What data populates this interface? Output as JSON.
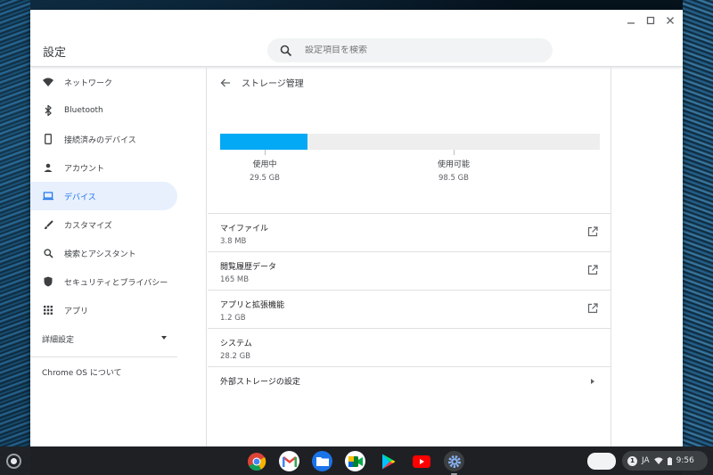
{
  "window": {
    "title": "設定",
    "search_placeholder": "設定項目を検索",
    "controls": [
      "minimize",
      "maximize",
      "close"
    ]
  },
  "sidebar": {
    "items": [
      {
        "label": "ネットワーク",
        "icon": "wifi-icon"
      },
      {
        "label": "Bluetooth",
        "icon": "bluetooth-icon"
      },
      {
        "label": "接続済みのデバイス",
        "icon": "phone-icon"
      },
      {
        "label": "アカウント",
        "icon": "person-icon"
      },
      {
        "label": "デバイス",
        "icon": "laptop-icon",
        "active": true
      },
      {
        "label": "カスタマイズ",
        "icon": "brush-icon"
      },
      {
        "label": "検索とアシスタント",
        "icon": "search-icon"
      },
      {
        "label": "セキュリティとプライバシー",
        "icon": "shield-icon"
      },
      {
        "label": "アプリ",
        "icon": "apps-grid-icon"
      }
    ],
    "advanced_label": "詳細設定",
    "about_label": "Chrome OS について"
  },
  "main": {
    "page_title": "ストレージ管理",
    "storage": {
      "used_fraction": 0.23,
      "used_label": "使用中",
      "used_value": "29.5 GB",
      "available_label": "使用可能",
      "available_value": "98.5 GB"
    },
    "rows": [
      {
        "title": "マイファイル",
        "value": "3.8 MB",
        "action": "external-link"
      },
      {
        "title": "閲覧履歴データ",
        "value": "165 MB",
        "action": "external-link"
      },
      {
        "title": "アプリと拡張機能",
        "value": "1.2 GB",
        "action": "external-link"
      },
      {
        "title": "システム",
        "value": "28.2 GB",
        "action": "none"
      }
    ],
    "external_storage_label": "外部ストレージの設定"
  },
  "shelf": {
    "apps": [
      "chrome-icon",
      "gmail-icon",
      "files-icon",
      "meet-icon",
      "play-store-icon",
      "youtube-icon",
      "settings-icon"
    ],
    "tray": {
      "notification_count": "1",
      "ime": "JA",
      "time": "9:56"
    }
  },
  "colors": {
    "accent": "#1a73e8",
    "storage_bar": "#03a9f4",
    "active_bg": "#e8f0fe"
  }
}
